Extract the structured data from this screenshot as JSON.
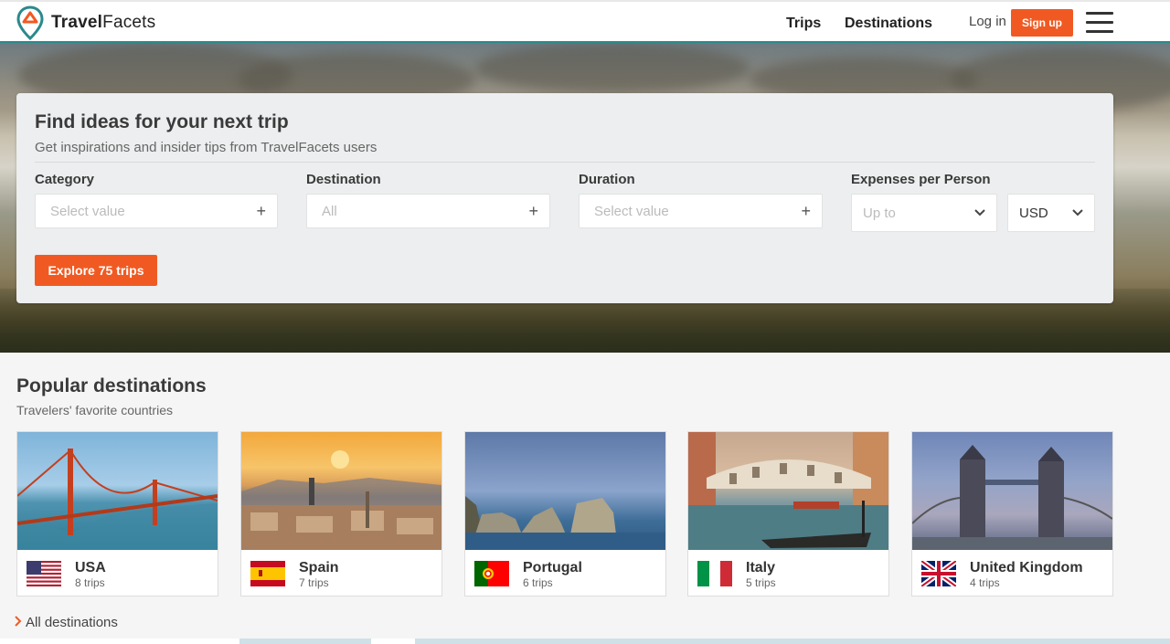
{
  "brand": {
    "name_bold": "Travel",
    "name_rest": "Facets"
  },
  "nav": {
    "trips": "Trips",
    "destinations": "Destinations",
    "login": "Log in",
    "signup": "Sign up"
  },
  "search": {
    "title": "Find ideas for your next trip",
    "subtitle": "Get inspirations and insider tips from TravelFacets users",
    "category": {
      "label": "Category",
      "placeholder": "Select value"
    },
    "destination": {
      "label": "Destination",
      "placeholder": "All"
    },
    "duration": {
      "label": "Duration",
      "placeholder": "Select value"
    },
    "expenses": {
      "label": "Expenses per Person",
      "placeholder": "Up to",
      "currency": "USD"
    },
    "explore_label": "Explore 75 trips"
  },
  "popular": {
    "title": "Popular destinations",
    "subtitle": "Travelers' favorite countries",
    "items": [
      {
        "name": "USA",
        "trips": "8 trips"
      },
      {
        "name": "Spain",
        "trips": "7 trips"
      },
      {
        "name": "Portugal",
        "trips": "6 trips"
      },
      {
        "name": "Italy",
        "trips": "5 trips"
      },
      {
        "name": "United Kingdom",
        "trips": "4 trips"
      }
    ],
    "all_label": "All destinations"
  },
  "colors": {
    "accent": "#f05a22",
    "teal": "#2a8a8c",
    "panel": "#eceeef"
  },
  "icons": [
    "location-pin-logo-icon",
    "plus-icon",
    "chevron-down-icon",
    "hamburger-menu-icon",
    "chevron-right-icon"
  ]
}
